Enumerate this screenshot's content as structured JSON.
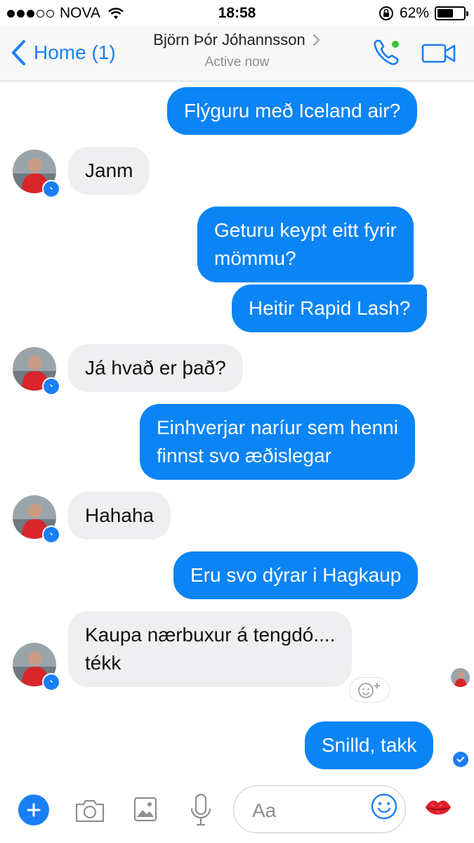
{
  "status_bar": {
    "carrier": "NOVA",
    "time": "18:58",
    "battery_text": "62%",
    "battery_level": 0.62
  },
  "header": {
    "back_label": "Home (1)",
    "contact_name": "Björn Þór Jóhannsson",
    "status": "Active now"
  },
  "messages": [
    {
      "from": "me",
      "text_lines": [
        "Flýguru með Iceland air?"
      ]
    },
    {
      "from": "them",
      "text_lines": [
        "Janm"
      ]
    },
    {
      "from": "me",
      "text_lines": [
        "Geturu keypt eitt fyrir",
        "mömmu?"
      ]
    },
    {
      "from": "me",
      "text_lines": [
        "Heitir Rapid Lash?"
      ]
    },
    {
      "from": "them",
      "text_lines": [
        "Já hvað er það?"
      ]
    },
    {
      "from": "me",
      "text_lines": [
        "Einhverjar naríur sem henni",
        "finnst svo æðislegar"
      ]
    },
    {
      "from": "them",
      "text_lines": [
        "Hahaha"
      ]
    },
    {
      "from": "me",
      "text_lines": [
        "Eru svo dýrar i Hagkaup"
      ]
    },
    {
      "from": "them",
      "text_lines": [
        "Kaupa nærbuxur á tengdó....",
        "tékk"
      ]
    },
    {
      "from": "me",
      "text_lines": [
        "Snilld, takk"
      ]
    }
  ],
  "composer": {
    "placeholder": "Aa"
  },
  "colors": {
    "accent": "#1a7ff5",
    "outgoing_bubble": "#0b84f5",
    "incoming_bubble": "#efeff1",
    "online_dot": "#3fc33a"
  },
  "icons": [
    "back-chevron-icon",
    "chevron-right-icon",
    "phone-icon",
    "video-camera-icon",
    "messenger-badge-icon",
    "add-reaction-icon",
    "plus-icon",
    "camera-icon",
    "gallery-icon",
    "microphone-icon",
    "emoji-icon",
    "kiss-lips-icon",
    "sent-check-icon",
    "wifi-icon",
    "rotation-lock-icon",
    "battery-icon"
  ]
}
